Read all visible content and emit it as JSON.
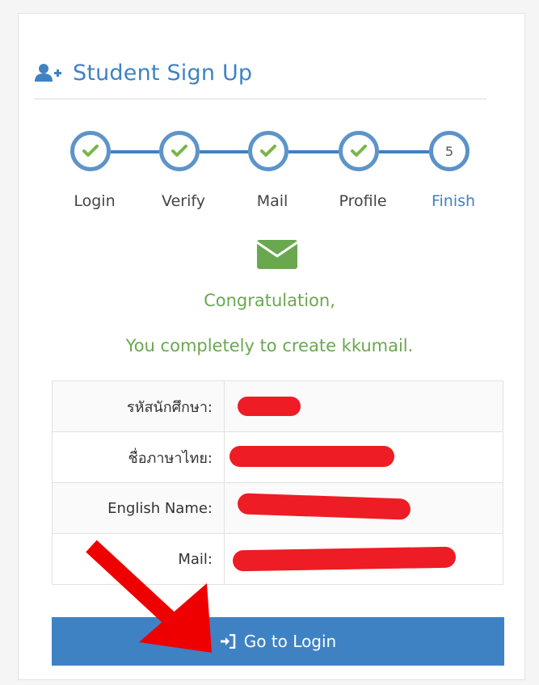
{
  "header": {
    "title": "Student Sign Up",
    "icon": "user-plus-icon"
  },
  "steps": [
    {
      "label": "Login",
      "state": "done"
    },
    {
      "label": "Verify",
      "state": "done"
    },
    {
      "label": "Mail",
      "state": "done"
    },
    {
      "label": "Profile",
      "state": "done"
    },
    {
      "label": "Finish",
      "state": "active",
      "number": "5"
    }
  ],
  "result": {
    "icon": "envelope-icon",
    "line1": "Congratulation,",
    "line2": "You completely to create kkumail."
  },
  "table": {
    "rows": [
      {
        "label": "รหัสนักศึกษา:",
        "value_redacted": true
      },
      {
        "label": "ชื่อภาษาไทย:",
        "value_redacted": true
      },
      {
        "label": "English Name:",
        "value_redacted": true
      },
      {
        "label": "Mail:",
        "value_redacted": true
      }
    ]
  },
  "actions": {
    "login_button": "Go to Login",
    "login_icon": "sign-in-icon"
  },
  "colors": {
    "accent": "#3e82c4",
    "success": "#6aa84f",
    "redaction": "#ee1c24"
  }
}
